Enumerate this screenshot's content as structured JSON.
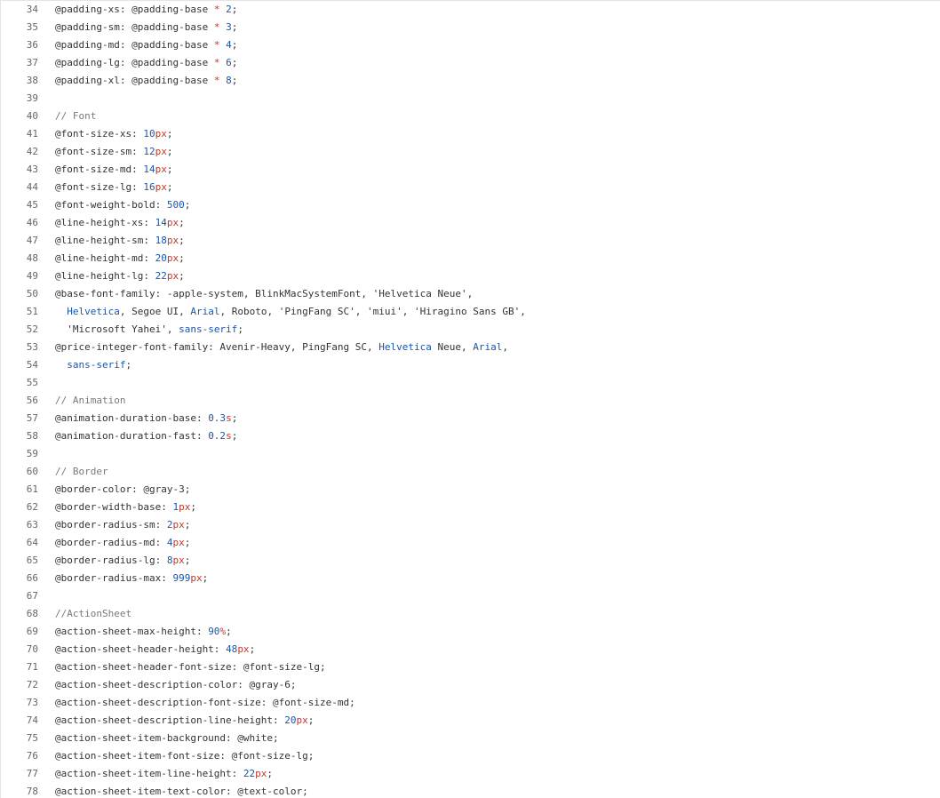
{
  "colors": {
    "text": "#333333",
    "line_number": "#666666",
    "number": "#1a56a8",
    "unit": "#c0392b",
    "operator": "#c0392b",
    "comment": "#7a7a7a",
    "keyword": "#1a56a8"
  },
  "code": {
    "lines": [
      {
        "n": "34",
        "tokens": [
          {
            "t": "text",
            "v": "@padding-xs: @padding-base "
          },
          {
            "t": "operator",
            "v": "*"
          },
          {
            "t": "text",
            "v": " "
          },
          {
            "t": "number",
            "v": "2"
          },
          {
            "t": "text",
            "v": ";"
          }
        ]
      },
      {
        "n": "35",
        "tokens": [
          {
            "t": "text",
            "v": "@padding-sm: @padding-base "
          },
          {
            "t": "operator",
            "v": "*"
          },
          {
            "t": "text",
            "v": " "
          },
          {
            "t": "number",
            "v": "3"
          },
          {
            "t": "text",
            "v": ";"
          }
        ]
      },
      {
        "n": "36",
        "tokens": [
          {
            "t": "text",
            "v": "@padding-md: @padding-base "
          },
          {
            "t": "operator",
            "v": "*"
          },
          {
            "t": "text",
            "v": " "
          },
          {
            "t": "number",
            "v": "4"
          },
          {
            "t": "text",
            "v": ";"
          }
        ]
      },
      {
        "n": "37",
        "tokens": [
          {
            "t": "text",
            "v": "@padding-lg: @padding-base "
          },
          {
            "t": "operator",
            "v": "*"
          },
          {
            "t": "text",
            "v": " "
          },
          {
            "t": "number",
            "v": "6"
          },
          {
            "t": "text",
            "v": ";"
          }
        ]
      },
      {
        "n": "38",
        "tokens": [
          {
            "t": "text",
            "v": "@padding-xl: @padding-base "
          },
          {
            "t": "operator",
            "v": "*"
          },
          {
            "t": "text",
            "v": " "
          },
          {
            "t": "number",
            "v": "8"
          },
          {
            "t": "text",
            "v": ";"
          }
        ]
      },
      {
        "n": "39",
        "tokens": []
      },
      {
        "n": "40",
        "tokens": [
          {
            "t": "comment",
            "v": "// Font"
          }
        ]
      },
      {
        "n": "41",
        "tokens": [
          {
            "t": "text",
            "v": "@font-size-xs: "
          },
          {
            "t": "number",
            "v": "10"
          },
          {
            "t": "unit",
            "v": "px"
          },
          {
            "t": "text",
            "v": ";"
          }
        ]
      },
      {
        "n": "42",
        "tokens": [
          {
            "t": "text",
            "v": "@font-size-sm: "
          },
          {
            "t": "number",
            "v": "12"
          },
          {
            "t": "unit",
            "v": "px"
          },
          {
            "t": "text",
            "v": ";"
          }
        ]
      },
      {
        "n": "43",
        "tokens": [
          {
            "t": "text",
            "v": "@font-size-md: "
          },
          {
            "t": "number",
            "v": "14"
          },
          {
            "t": "unit",
            "v": "px"
          },
          {
            "t": "text",
            "v": ";"
          }
        ]
      },
      {
        "n": "44",
        "tokens": [
          {
            "t": "text",
            "v": "@font-size-lg: "
          },
          {
            "t": "number",
            "v": "16"
          },
          {
            "t": "unit",
            "v": "px"
          },
          {
            "t": "text",
            "v": ";"
          }
        ]
      },
      {
        "n": "45",
        "tokens": [
          {
            "t": "text",
            "v": "@font-weight-bold: "
          },
          {
            "t": "number",
            "v": "500"
          },
          {
            "t": "text",
            "v": ";"
          }
        ]
      },
      {
        "n": "46",
        "tokens": [
          {
            "t": "text",
            "v": "@line-height-xs: "
          },
          {
            "t": "number",
            "v": "14"
          },
          {
            "t": "unit",
            "v": "px"
          },
          {
            "t": "text",
            "v": ";"
          }
        ]
      },
      {
        "n": "47",
        "tokens": [
          {
            "t": "text",
            "v": "@line-height-sm: "
          },
          {
            "t": "number",
            "v": "18"
          },
          {
            "t": "unit",
            "v": "px"
          },
          {
            "t": "text",
            "v": ";"
          }
        ]
      },
      {
        "n": "48",
        "tokens": [
          {
            "t": "text",
            "v": "@line-height-md: "
          },
          {
            "t": "number",
            "v": "20"
          },
          {
            "t": "unit",
            "v": "px"
          },
          {
            "t": "text",
            "v": ";"
          }
        ]
      },
      {
        "n": "49",
        "tokens": [
          {
            "t": "text",
            "v": "@line-height-lg: "
          },
          {
            "t": "number",
            "v": "22"
          },
          {
            "t": "unit",
            "v": "px"
          },
          {
            "t": "text",
            "v": ";"
          }
        ]
      },
      {
        "n": "50",
        "tokens": [
          {
            "t": "text",
            "v": "@base-font-family: -apple-system, BlinkMacSystemFont, 'Helvetica Neue',"
          }
        ]
      },
      {
        "n": "51",
        "tokens": [
          {
            "t": "text",
            "v": "  "
          },
          {
            "t": "keyword",
            "v": "Helvetica"
          },
          {
            "t": "text",
            "v": ", Segoe UI, "
          },
          {
            "t": "keyword",
            "v": "Arial"
          },
          {
            "t": "text",
            "v": ", Roboto, 'PingFang SC', 'miui', 'Hiragino Sans GB',"
          }
        ]
      },
      {
        "n": "52",
        "tokens": [
          {
            "t": "text",
            "v": "  'Microsoft Yahei', "
          },
          {
            "t": "keyword",
            "v": "sans-serif"
          },
          {
            "t": "text",
            "v": ";"
          }
        ]
      },
      {
        "n": "53",
        "tokens": [
          {
            "t": "text",
            "v": "@price-integer-font-family: Avenir-Heavy, PingFang SC, "
          },
          {
            "t": "keyword",
            "v": "Helvetica"
          },
          {
            "t": "text",
            "v": " Neue, "
          },
          {
            "t": "keyword",
            "v": "Arial"
          },
          {
            "t": "text",
            "v": ","
          }
        ]
      },
      {
        "n": "54",
        "tokens": [
          {
            "t": "text",
            "v": "  "
          },
          {
            "t": "keyword",
            "v": "sans-serif"
          },
          {
            "t": "text",
            "v": ";"
          }
        ]
      },
      {
        "n": "55",
        "tokens": []
      },
      {
        "n": "56",
        "tokens": [
          {
            "t": "comment",
            "v": "// Animation"
          }
        ]
      },
      {
        "n": "57",
        "tokens": [
          {
            "t": "text",
            "v": "@animation-duration-base: "
          },
          {
            "t": "number",
            "v": "0.3"
          },
          {
            "t": "unit",
            "v": "s"
          },
          {
            "t": "text",
            "v": ";"
          }
        ]
      },
      {
        "n": "58",
        "tokens": [
          {
            "t": "text",
            "v": "@animation-duration-fast: "
          },
          {
            "t": "number",
            "v": "0.2"
          },
          {
            "t": "unit",
            "v": "s"
          },
          {
            "t": "text",
            "v": ";"
          }
        ]
      },
      {
        "n": "59",
        "tokens": []
      },
      {
        "n": "60",
        "tokens": [
          {
            "t": "comment",
            "v": "// Border"
          }
        ]
      },
      {
        "n": "61",
        "tokens": [
          {
            "t": "text",
            "v": "@border-color: @gray-3;"
          }
        ]
      },
      {
        "n": "62",
        "tokens": [
          {
            "t": "text",
            "v": "@border-width-base: "
          },
          {
            "t": "number",
            "v": "1"
          },
          {
            "t": "unit",
            "v": "px"
          },
          {
            "t": "text",
            "v": ";"
          }
        ]
      },
      {
        "n": "63",
        "tokens": [
          {
            "t": "text",
            "v": "@border-radius-sm: "
          },
          {
            "t": "number",
            "v": "2"
          },
          {
            "t": "unit",
            "v": "px"
          },
          {
            "t": "text",
            "v": ";"
          }
        ]
      },
      {
        "n": "64",
        "tokens": [
          {
            "t": "text",
            "v": "@border-radius-md: "
          },
          {
            "t": "number",
            "v": "4"
          },
          {
            "t": "unit",
            "v": "px"
          },
          {
            "t": "text",
            "v": ";"
          }
        ]
      },
      {
        "n": "65",
        "tokens": [
          {
            "t": "text",
            "v": "@border-radius-lg: "
          },
          {
            "t": "number",
            "v": "8"
          },
          {
            "t": "unit",
            "v": "px"
          },
          {
            "t": "text",
            "v": ";"
          }
        ]
      },
      {
        "n": "66",
        "tokens": [
          {
            "t": "text",
            "v": "@border-radius-max: "
          },
          {
            "t": "number",
            "v": "999"
          },
          {
            "t": "unit",
            "v": "px"
          },
          {
            "t": "text",
            "v": ";"
          }
        ]
      },
      {
        "n": "67",
        "tokens": []
      },
      {
        "n": "68",
        "tokens": [
          {
            "t": "comment",
            "v": "//ActionSheet"
          }
        ]
      },
      {
        "n": "69",
        "tokens": [
          {
            "t": "text",
            "v": "@action-sheet-max-height: "
          },
          {
            "t": "number",
            "v": "90"
          },
          {
            "t": "unit",
            "v": "%"
          },
          {
            "t": "text",
            "v": ";"
          }
        ]
      },
      {
        "n": "70",
        "tokens": [
          {
            "t": "text",
            "v": "@action-sheet-header-height: "
          },
          {
            "t": "number",
            "v": "48"
          },
          {
            "t": "unit",
            "v": "px"
          },
          {
            "t": "text",
            "v": ";"
          }
        ]
      },
      {
        "n": "71",
        "tokens": [
          {
            "t": "text",
            "v": "@action-sheet-header-font-size: @font-size-lg;"
          }
        ]
      },
      {
        "n": "72",
        "tokens": [
          {
            "t": "text",
            "v": "@action-sheet-description-color: @gray-6;"
          }
        ]
      },
      {
        "n": "73",
        "tokens": [
          {
            "t": "text",
            "v": "@action-sheet-description-font-size: @font-size-md;"
          }
        ]
      },
      {
        "n": "74",
        "tokens": [
          {
            "t": "text",
            "v": "@action-sheet-description-line-height: "
          },
          {
            "t": "number",
            "v": "20"
          },
          {
            "t": "unit",
            "v": "px"
          },
          {
            "t": "text",
            "v": ";"
          }
        ]
      },
      {
        "n": "75",
        "tokens": [
          {
            "t": "text",
            "v": "@action-sheet-item-background: @white;"
          }
        ]
      },
      {
        "n": "76",
        "tokens": [
          {
            "t": "text",
            "v": "@action-sheet-item-font-size: @font-size-lg;"
          }
        ]
      },
      {
        "n": "77",
        "tokens": [
          {
            "t": "text",
            "v": "@action-sheet-item-line-height: "
          },
          {
            "t": "number",
            "v": "22"
          },
          {
            "t": "unit",
            "v": "px"
          },
          {
            "t": "text",
            "v": ";"
          }
        ]
      },
      {
        "n": "78",
        "tokens": [
          {
            "t": "text",
            "v": "@action-sheet-item-text-color: @text-color;"
          }
        ]
      }
    ]
  }
}
